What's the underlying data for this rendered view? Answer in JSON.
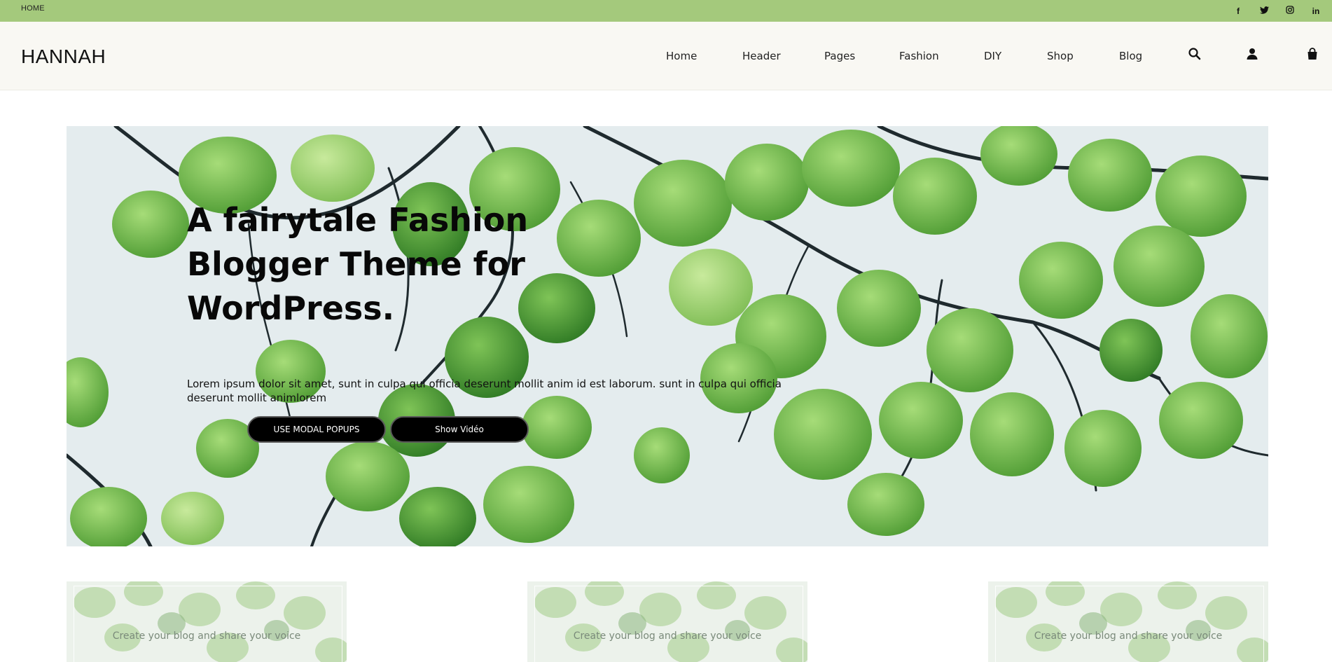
{
  "topbar": {
    "home_label": "HOME",
    "social_icons": [
      "facebook-icon",
      "twitter-icon",
      "instagram-icon",
      "linkedin-icon"
    ],
    "social_glyphs": [
      "f",
      "t",
      "◎",
      "in"
    ],
    "background": "#a4c97c"
  },
  "header": {
    "logo": "HANNAH",
    "nav": [
      "Home",
      "Header",
      "Pages",
      "Fashion",
      "DIY",
      "Shop",
      "Blog"
    ],
    "icons": [
      "search-icon",
      "user-icon",
      "cart-icon"
    ],
    "background": "#f9f8f3"
  },
  "hero": {
    "title": "A fairytale Fashion Blogger Theme for WordPress.",
    "text": "Lorem ipsum dolor sit amet, sunt in culpa qui officia deserunt mollit anim id est laborum. sunt in culpa qui officia deserunt mollit animlorem",
    "button_primary": "USE MODAL POPUPS",
    "button_secondary": "Show Vidéo"
  },
  "cards": [
    {
      "text": "Create your blog and share your voice"
    },
    {
      "text": "Create your blog and share your voice"
    },
    {
      "text": "Create your blog and share your voice"
    }
  ],
  "colors": {
    "leaf": "#5aa83c",
    "leaf_light": "#8fcc64",
    "branch": "#1f2a2e",
    "accent": "#a4c97c"
  }
}
